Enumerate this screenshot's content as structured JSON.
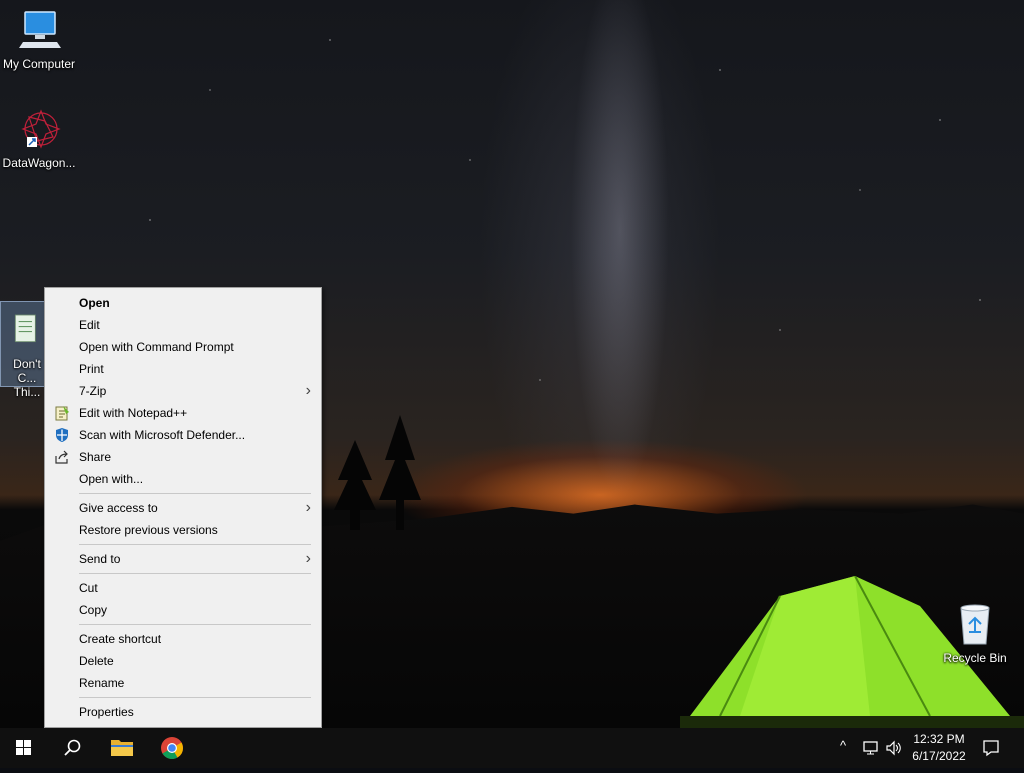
{
  "desktop": {
    "icons": [
      {
        "label": "My Computer"
      },
      {
        "label": "DataWagon..."
      },
      {
        "label": "Don't C... Thi..."
      },
      {
        "label": "Recycle Bin"
      }
    ]
  },
  "context_menu": {
    "items": [
      {
        "label": "Open"
      },
      {
        "label": "Edit"
      },
      {
        "label": "Open with Command Prompt"
      },
      {
        "label": "Print"
      },
      {
        "label": "7-Zip"
      },
      {
        "label": "Edit with Notepad++"
      },
      {
        "label": "Scan with Microsoft Defender..."
      },
      {
        "label": "Share"
      },
      {
        "label": "Open with..."
      },
      {
        "label": "Give access to"
      },
      {
        "label": "Restore previous versions"
      },
      {
        "label": "Send to"
      },
      {
        "label": "Cut"
      },
      {
        "label": "Copy"
      },
      {
        "label": "Create shortcut"
      },
      {
        "label": "Delete"
      },
      {
        "label": "Rename"
      },
      {
        "label": "Properties"
      }
    ],
    "submenu_arrow": "›"
  },
  "taskbar": {
    "clock_time": "12:32 PM",
    "clock_date": "6/17/2022",
    "tray_chevron": "^"
  },
  "colors": {
    "menu_bg": "#f0f0f0",
    "taskbar_bg": "#101010",
    "tent_green": "#8ee02a"
  }
}
